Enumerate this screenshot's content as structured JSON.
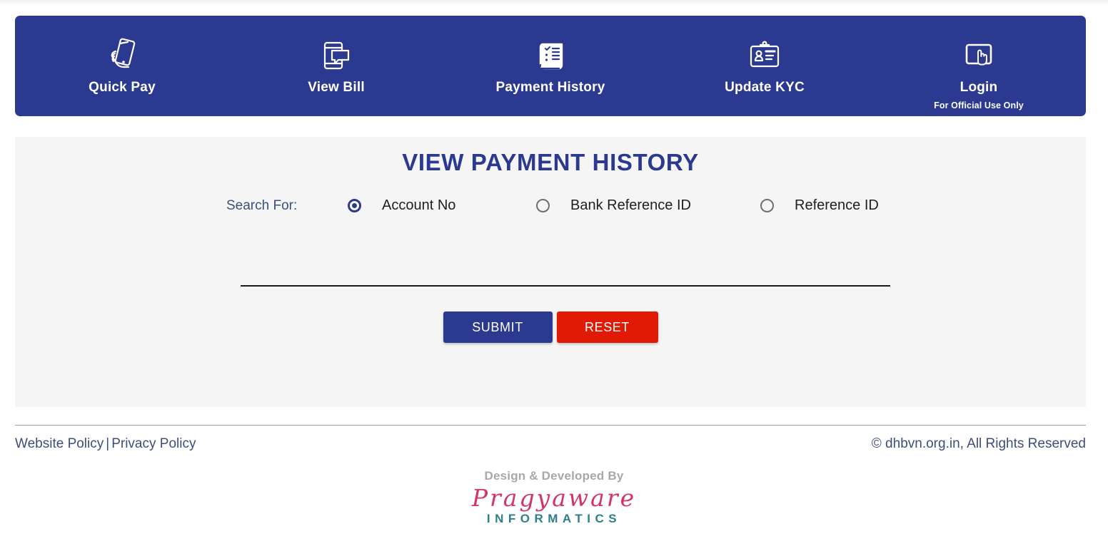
{
  "header": {
    "nav_items": [
      {
        "label": "Quick Pay",
        "icon": "hand-holding-phone-icon",
        "sublabel": ""
      },
      {
        "label": "View Bill",
        "icon": "phone-message-icon",
        "sublabel": ""
      },
      {
        "label": "Payment History",
        "icon": "receipt-checklist-icon",
        "sublabel": ""
      },
      {
        "label": "Update KYC",
        "icon": "id-card-icon",
        "sublabel": ""
      },
      {
        "label": "Login",
        "icon": "tablet-touch-icon",
        "sublabel": "For Official Use Only"
      }
    ]
  },
  "main": {
    "title": "VIEW PAYMENT HISTORY",
    "search_for_label": "Search For:",
    "radio_options": [
      {
        "label": "Account No",
        "selected": true
      },
      {
        "label": "Bank Reference ID",
        "selected": false
      },
      {
        "label": "Reference ID",
        "selected": false
      }
    ],
    "search_input": {
      "value": "",
      "placeholder": ""
    },
    "submit_label": "SUBMIT",
    "reset_label": "RESET"
  },
  "footer": {
    "website_policy": "Website Policy",
    "separator": "|",
    "privacy_policy": "Privacy Policy",
    "copyright": "© dhbvn.org.in, All Rights Reserved",
    "credit_text": "Design & Developed By",
    "brand_name": "Pragyaware",
    "brand_sub": "INFORMATICS"
  },
  "colors": {
    "header_blue": "#2b3990",
    "panel_bg": "#f5f5f5",
    "reset_red": "#e01a05",
    "brand_pink": "#d6326a",
    "brand_teal": "#2d7f88"
  }
}
